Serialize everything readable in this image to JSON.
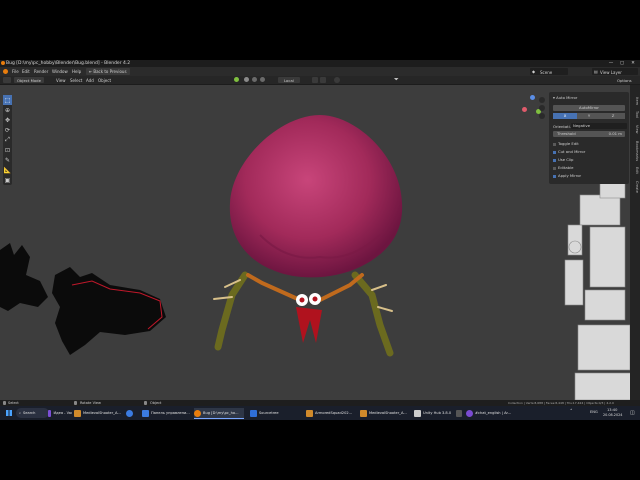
{
  "window": {
    "title": "Bug [D:\\my\\pc_hobby\\Blender\\Bug.blend] - Blender 4.2",
    "minimize": "—",
    "maximize": "▢",
    "close": "✕"
  },
  "menubar": {
    "items": [
      "File",
      "Edit",
      "Render",
      "Window",
      "Help"
    ],
    "back_button": "Back to Previous",
    "scene": "Scene",
    "view_layer": "View Layer"
  },
  "header": {
    "mode": "Object Mode",
    "menus": [
      "View",
      "Select",
      "Add",
      "Object"
    ],
    "orientation": "Local",
    "options": "Options"
  },
  "npanel": {
    "title": "Auto Mirror",
    "auto_mirror_button": "AutoMirror",
    "axes": [
      "X",
      "Y",
      "Z"
    ],
    "orientation_label": "Orientati...",
    "orientation_value": "Negative",
    "threshold_label": "Threshold",
    "threshold_value": "0.01 m",
    "toggle_edit": "Toggle Edit",
    "checkboxes": [
      {
        "label": "Cut and Mirror",
        "checked": true
      },
      {
        "label": "Use Clip",
        "checked": true
      },
      {
        "label": "Editable",
        "checked": false
      },
      {
        "label": "Apply Mirror",
        "checked": true
      }
    ]
  },
  "side_tabs": [
    "Item",
    "Tool",
    "View",
    "Bookmarks",
    "Edit",
    "Create"
  ],
  "statusbar": {
    "left": [
      "Select",
      "Rotate View",
      "Object"
    ],
    "right": "Collection | Verts:8,688 | Faces:8,448 | Tris:17,424 | Objects:0/3 | 4.2.0"
  },
  "taskbar": {
    "search": "Search",
    "items": [
      {
        "label": "Идея - Vault - Obsi...",
        "color": "#7b4fd6"
      },
      {
        "label": "MedievalShooter_A...",
        "color": "#d08a2b"
      },
      {
        "label": "",
        "color": "#3b7be0"
      },
      {
        "label": "Панель управлени...",
        "color": "#3b7be0"
      },
      {
        "label": "Bug [D:\\my\\pc_ho...",
        "color": "#e87d0d",
        "active": true
      },
      {
        "label": "Sourcetree",
        "color": "#2f6fd8"
      },
      {
        "label": "ArmoredSquad202...",
        "color": "#d08a2b"
      },
      {
        "label": "MedievalShooter_A...",
        "color": "#d08a2b"
      },
      {
        "label": "Unity Hub 3.8.0",
        "color": "#cccccc"
      },
      {
        "label": "",
        "color": "#555555"
      },
      {
        "label": "#chat_english | Ar...",
        "color": "#7a4bd1"
      }
    ],
    "lang": "ENG",
    "time": "13:40",
    "date": "20.08.2024"
  }
}
